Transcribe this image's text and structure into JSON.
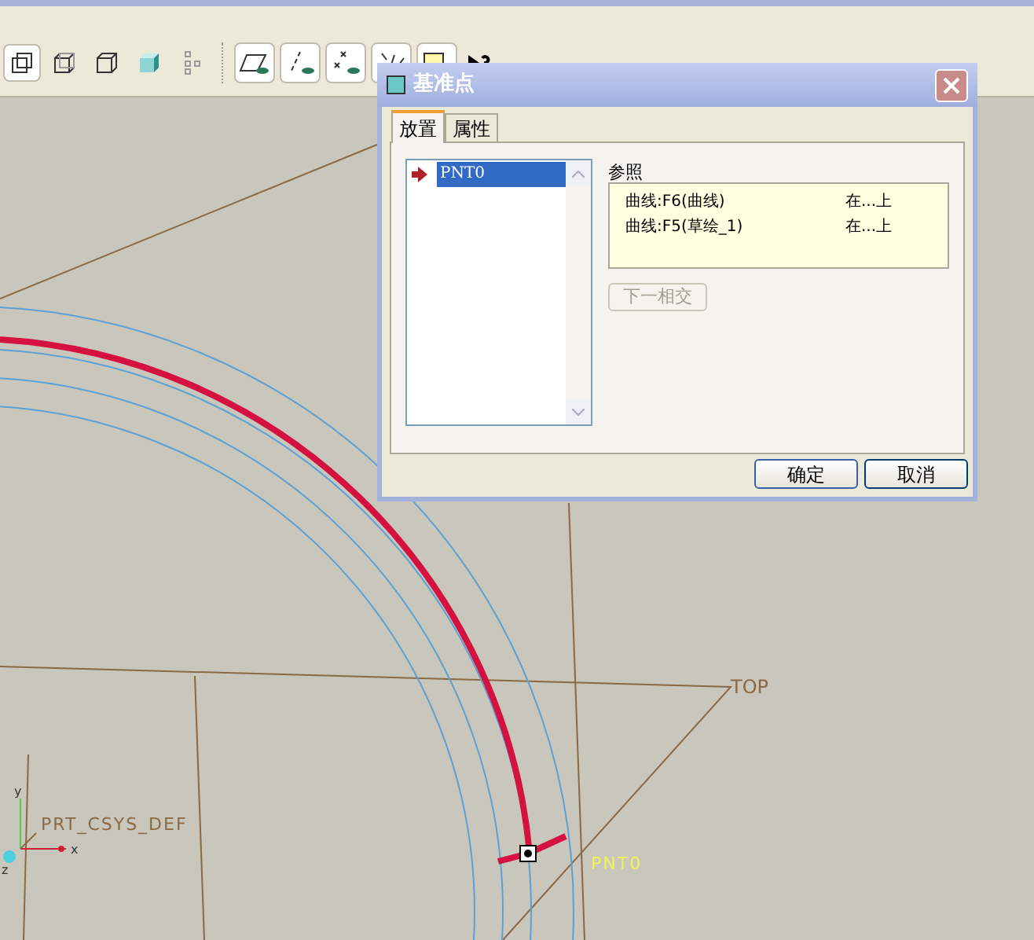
{
  "canvas": {
    "datum_plane_label": "TOP",
    "csys_label": "PRT_CSYS_DEF",
    "axis_labels": [
      "x",
      "y",
      "z"
    ],
    "point_label": "PNT0"
  },
  "dialog": {
    "title": "基准点",
    "tabs": [
      {
        "label": "放置",
        "selected": true
      },
      {
        "label": "属性",
        "selected": false
      }
    ],
    "points": [
      {
        "name": "PNT0",
        "selected": true
      }
    ],
    "references_label": "参照",
    "references": [
      {
        "reference": "曲线:F6(曲线)",
        "constraint": "在...上"
      },
      {
        "reference": "曲线:F5(草绘_1)",
        "constraint": "在...上"
      }
    ],
    "next_intersection_button": {
      "label": "下一相交",
      "disabled": true
    },
    "buttons": [
      "确定",
      "取消"
    ]
  }
}
